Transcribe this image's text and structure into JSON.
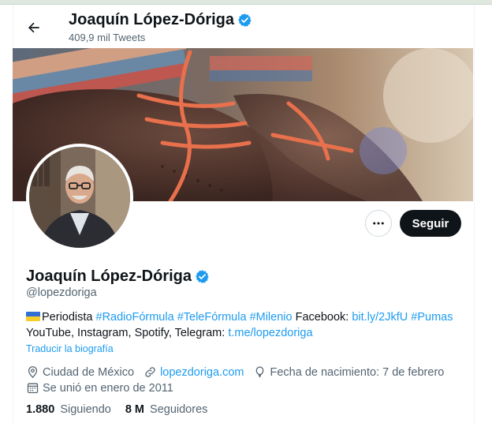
{
  "header": {
    "name": "Joaquín López-Dóriga",
    "tweets_count": "409,9 mil Tweets"
  },
  "actions": {
    "more_icon": "ellipsis-icon",
    "follow_label": "Seguir"
  },
  "profile": {
    "name": "Joaquín López-Dóriga",
    "handle": "@lopezdoriga",
    "verified": true,
    "verified_color": "#1d9bf0"
  },
  "bio": {
    "line1": {
      "text1": "Periodista ",
      "tag1": "#RadioFórmula",
      "sp1": " ",
      "tag2": "#TeleFórmula",
      "sp2": " ",
      "tag3": "#Milenio",
      "text2": " Facebook: ",
      "link1": "bit.ly/2JkfU",
      "sp3": " ",
      "tag4": "#Pumas"
    },
    "line2": {
      "text": "YouTube, Instagram, Spotify, Telegram: ",
      "link": "t.me/lopezdoriga"
    },
    "translate": "Traducir la biografía"
  },
  "meta": {
    "location": "Ciudad de México",
    "website": "lopezdoriga.com",
    "birthday": "Fecha de nacimiento: 7 de febrero",
    "joined": "Se unió en enero de 2011"
  },
  "stats": {
    "following_count": "1.880",
    "following_label": "Siguiendo",
    "followers_count": "8 M",
    "followers_label": "Seguidores"
  },
  "colors": {
    "accent": "#1d9bf0",
    "text": "#0f1419",
    "secondary": "#536471"
  }
}
